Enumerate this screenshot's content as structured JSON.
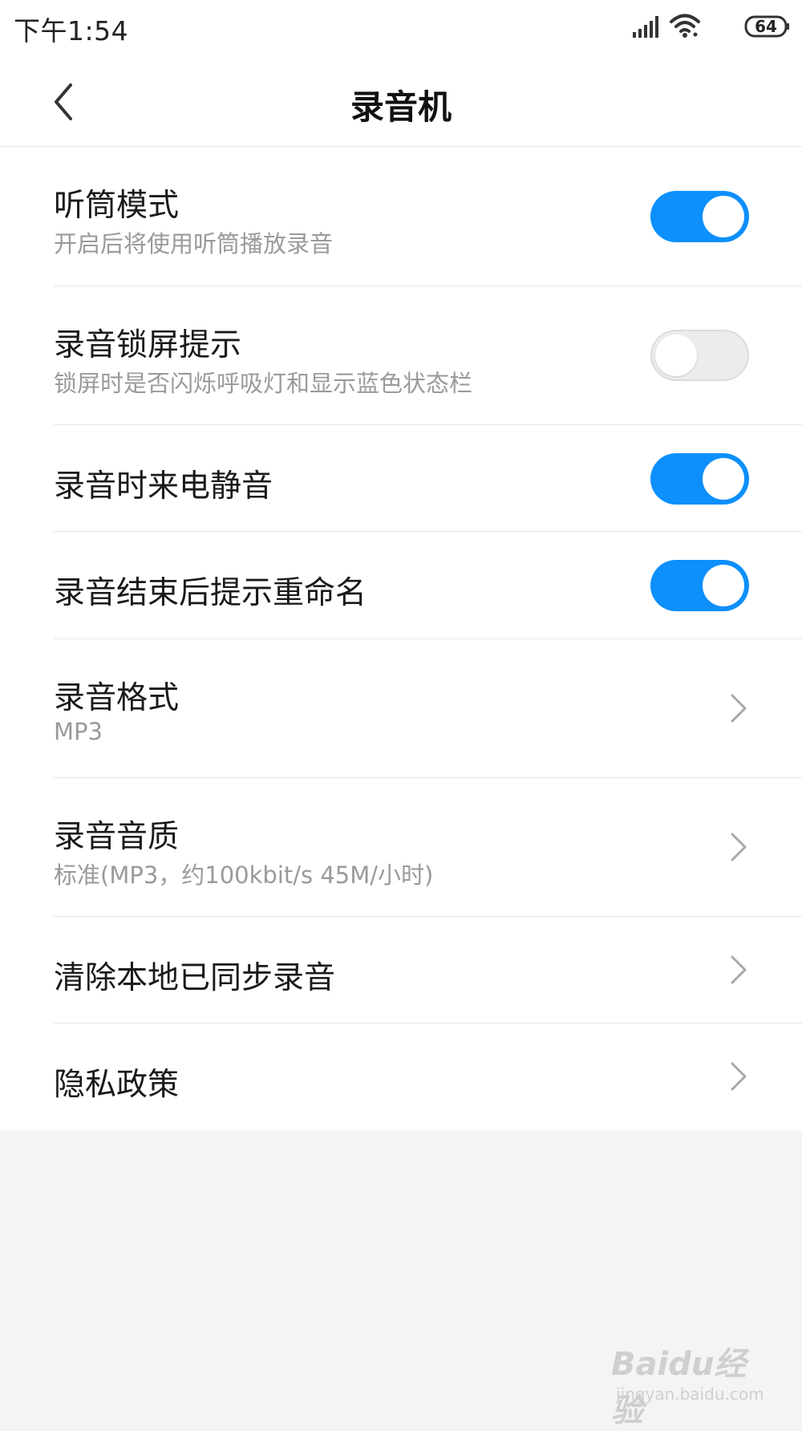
{
  "status_bar": {
    "time": "下午1:54",
    "battery": "64",
    "icons": [
      "signal-icon",
      "wifi-icon",
      "battery-icon"
    ]
  },
  "header": {
    "title": "录音机",
    "back_icon": "chevron-left-icon"
  },
  "settings": [
    {
      "title": "听筒模式",
      "subtitle": "开启后将使用听筒播放录音",
      "control": "toggle",
      "on": true
    },
    {
      "title": "录音锁屏提示",
      "subtitle": "锁屏时是否闪烁呼吸灯和显示蓝色状态栏",
      "control": "toggle",
      "on": false
    },
    {
      "title": "录音时来电静音",
      "control": "toggle",
      "on": true
    },
    {
      "title": "录音结束后提示重命名",
      "control": "toggle",
      "on": true
    },
    {
      "title": "录音格式",
      "subtitle": "MP3",
      "control": "chevron"
    },
    {
      "title": "录音音质",
      "subtitle": "标准(MP3，约100kbit/s 45M/小时)",
      "control": "chevron"
    },
    {
      "title": "清除本地已同步录音",
      "control": "chevron"
    },
    {
      "title": "隐私政策",
      "control": "chevron"
    }
  ],
  "colors": {
    "accent": "#0d8ffc",
    "toggle_off": "#ececec",
    "background": "#f4f4f4",
    "subtitle": "#9a9a9a"
  },
  "watermark": {
    "logo": "Baidu经验",
    "url": "jingyan.baidu.com"
  }
}
